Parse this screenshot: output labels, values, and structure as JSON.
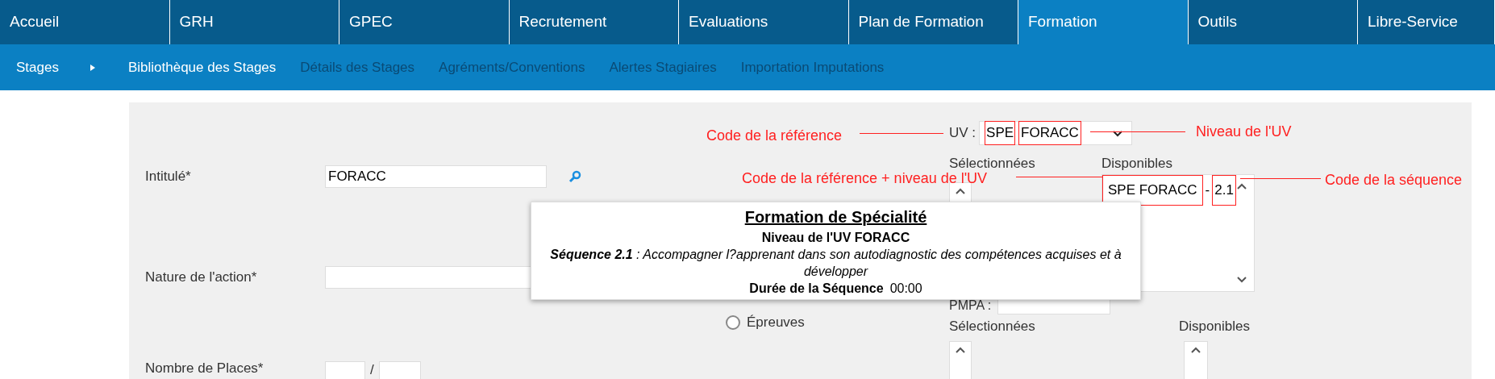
{
  "nav": [
    {
      "label": "Accueil",
      "selected": false
    },
    {
      "label": "GRH",
      "selected": false
    },
    {
      "label": "GPEC",
      "selected": false
    },
    {
      "label": "Recrutement",
      "selected": false
    },
    {
      "label": "Evaluations",
      "selected": false
    },
    {
      "label": "Plan de Formation",
      "selected": false
    },
    {
      "label": "Formation",
      "selected": true
    },
    {
      "label": "Outils",
      "selected": false
    },
    {
      "label": "Libre-Service",
      "selected": false
    }
  ],
  "subnav": {
    "section": "Stages",
    "items": [
      {
        "label": "Bibliothèque des Stages",
        "selected": true
      },
      {
        "label": "Détails des Stages",
        "selected": false
      },
      {
        "label": "Agréments/Conventions",
        "selected": false
      },
      {
        "label": "Alertes Stagiaires",
        "selected": false
      },
      {
        "label": "Importation Imputations",
        "selected": false
      }
    ]
  },
  "form": {
    "intitule": {
      "label": "Intitulé*",
      "value": "FORACC"
    },
    "nature": {
      "label": "Nature de l'action*"
    },
    "places": {
      "label": "Nombre de Places*",
      "separator": "/"
    },
    "epreuves": {
      "label": "Épreuves",
      "selected": false
    },
    "uv": {
      "label": "UV :",
      "reference": "SPE",
      "niveau": "FORACC"
    },
    "uv_lists": {
      "selected_label": "Sélectionnées",
      "available_label": "Disponibles",
      "available_options": [
        {
          "reference_niveau": "SPE FORACC",
          "separator": "-",
          "sequence": "2.1"
        }
      ]
    },
    "pmpa": {
      "label": "PMPA :"
    },
    "pmpa_lists": {
      "selected_label": "Sélectionnées",
      "available_label": "Disponibles"
    }
  },
  "annotations": {
    "reference": "Code de la référence",
    "niveau": "Niveau de l'UV",
    "reference_niveau": "Code de la référence + niveau de l'UV",
    "sequence": "Code de la séquence"
  },
  "tooltip": {
    "title": "Formation de Spécialité",
    "subtitle": "Niveau de l'UV FORACC",
    "description": "**Séquence 2.1** : Accompagner l?apprenant dans son autodiagnostic des compétences acquises et à développer",
    "duration_label": "Durée de la Séquence",
    "duration_value": "00:00"
  }
}
